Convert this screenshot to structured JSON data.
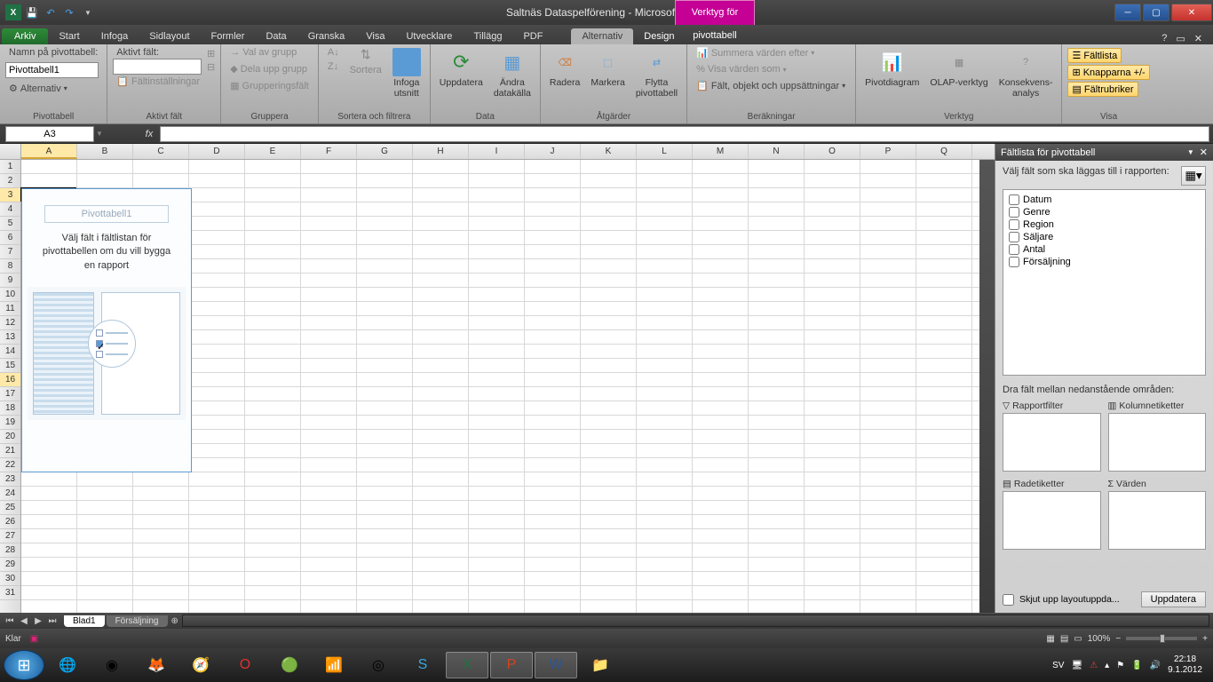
{
  "title": "Saltnäs Dataspelförening - Microsoft Excel",
  "context_tab_title": "Verktyg för pivottabell",
  "tabs": {
    "file": "Arkiv",
    "items": [
      "Start",
      "Infoga",
      "Sidlayout",
      "Formler",
      "Data",
      "Granska",
      "Visa",
      "Utvecklare",
      "Tillägg",
      "PDF"
    ],
    "context": [
      "Alternativ",
      "Design"
    ],
    "active": "Alternativ"
  },
  "ribbon": {
    "g1": {
      "label": "Pivottabell",
      "name_label": "Namn på pivottabell:",
      "name_value": "Pivottabell1",
      "options": "Alternativ"
    },
    "g2": {
      "label": "Aktivt fält",
      "active_label": "Aktivt fält:",
      "settings": "Fältinställningar"
    },
    "g3": {
      "label": "Gruppera",
      "sel": "Val av grupp",
      "ungroup": "Dela upp grupp",
      "field": "Grupperingsfält"
    },
    "g4": {
      "label": "Sortera och filtrera",
      "sort": "Sortera",
      "slicer": "Infoga\nutsnitt"
    },
    "g5": {
      "label": "Data",
      "refresh": "Uppdatera",
      "change": "Ändra\ndatakälla"
    },
    "g6": {
      "label": "Åtgärder",
      "clear": "Radera",
      "select": "Markera",
      "move": "Flytta\npivottabell"
    },
    "g7": {
      "label": "Beräkningar",
      "sum": "Summera värden efter",
      "show": "Visa värden som",
      "fields": "Fält, objekt och uppsättningar"
    },
    "g8": {
      "label": "Verktyg",
      "chart": "Pivotdiagram",
      "olap": "OLAP-verktyg",
      "whatif": "Konsekvens-\nanalys"
    },
    "g9": {
      "label": "Visa",
      "fl": "Fältlista",
      "btns": "Knapparna +/-",
      "hdrs": "Fältrubriker"
    }
  },
  "name_box": "A3",
  "pivot_placeholder": {
    "title": "Pivottabell1",
    "msg": "Välj fält i fältlistan för pivottabellen om du vill bygga en rapport"
  },
  "cols": [
    "A",
    "B",
    "C",
    "D",
    "E",
    "F",
    "G",
    "H",
    "I",
    "J",
    "K",
    "L",
    "M",
    "N",
    "O",
    "P",
    "Q"
  ],
  "pane": {
    "title": "Fältlista för pivottabell",
    "sub": "Välj fält som ska läggas till i rapporten:",
    "fields": [
      "Datum",
      "Genre",
      "Region",
      "Säljare",
      "Antal",
      "Försäljning"
    ],
    "areas_label": "Dra fält mellan nedanstående områden:",
    "areas": {
      "rf": "Rapportfilter",
      "cl": "Kolumnetiketter",
      "rl": "Radetiketter",
      "vl": "Värden"
    },
    "defer": "Skjut upp layoutuppda...",
    "update": "Uppdatera"
  },
  "sheets": {
    "active": "Blad1",
    "others": [
      "Försäljning"
    ]
  },
  "status": {
    "ready": "Klar",
    "zoom": "100%"
  },
  "tray": {
    "lang": "SV",
    "time": "22:18",
    "date": "9.1.2012"
  }
}
